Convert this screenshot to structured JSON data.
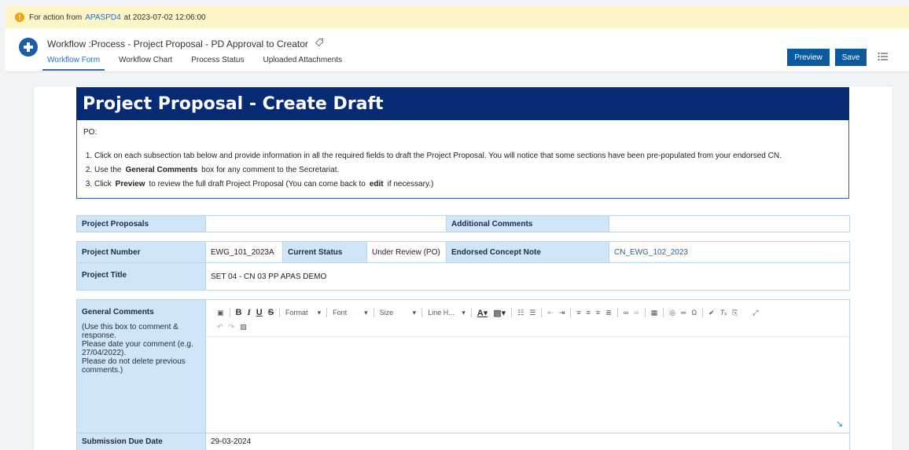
{
  "notification": {
    "prefix": "For action from",
    "user": "APASPD4",
    "suffix": "at 2023-07-02 12:06:00"
  },
  "header": {
    "title": "Workflow :Process - Project Proposal - PD Approval to Creator",
    "tabs": [
      "Workflow Form",
      "Workflow Chart",
      "Process Status",
      "Uploaded Attachments"
    ],
    "preview_label": "Preview",
    "save_label": "Save"
  },
  "form": {
    "heading": "Project Proposal - Create Draft",
    "po_label": "PO:",
    "instructions": {
      "i1": "Click on each subsection tab below and provide information in all the required fields to draft the Project Proposal.  You will notice that some sections have been pre-populated from your endorsed CN.",
      "i2_pre": "Use the",
      "i2_bold": "General Comments",
      "i2_post": "box for any comment to the Secretariat.",
      "i3_pre": "Click",
      "i3_bold1": "Preview",
      "i3_mid": "to review the full draft Project Proposal (You can come back to",
      "i3_bold2": "edit",
      "i3_post": "if necessary.)"
    },
    "row1": {
      "proposals_label": "Project Proposals",
      "additional_label": "Additional Comments"
    },
    "project_number_label": "Project Number",
    "project_number": "EWG_101_2023A",
    "current_status_label": "Current Status",
    "current_status": "Under Review (PO)",
    "endorsed_label": "Endorsed Concept Note",
    "endorsed_value": "CN_EWG_102_2023",
    "project_title_label": "Project Title",
    "project_title": "SET 04 - CN 03 PP APAS DEMO",
    "general_comments_label": "General Comments",
    "general_comments_hint": "(Use this box to comment & response.\nPlease date your comment (e.g. 27/04/2022).\nPlease do not delete previous comments.)",
    "toolbar": {
      "format": "Format",
      "font": "Font",
      "size": "Size",
      "line_height": "Line H..."
    },
    "submission_label": "Submission Due Date",
    "submission_value": "29-03-2024"
  },
  "colors": {
    "banner": "#062a74",
    "label_bg": "#cfe6f8",
    "button": "#0b5a9e",
    "notification": "#fbf5c8"
  }
}
